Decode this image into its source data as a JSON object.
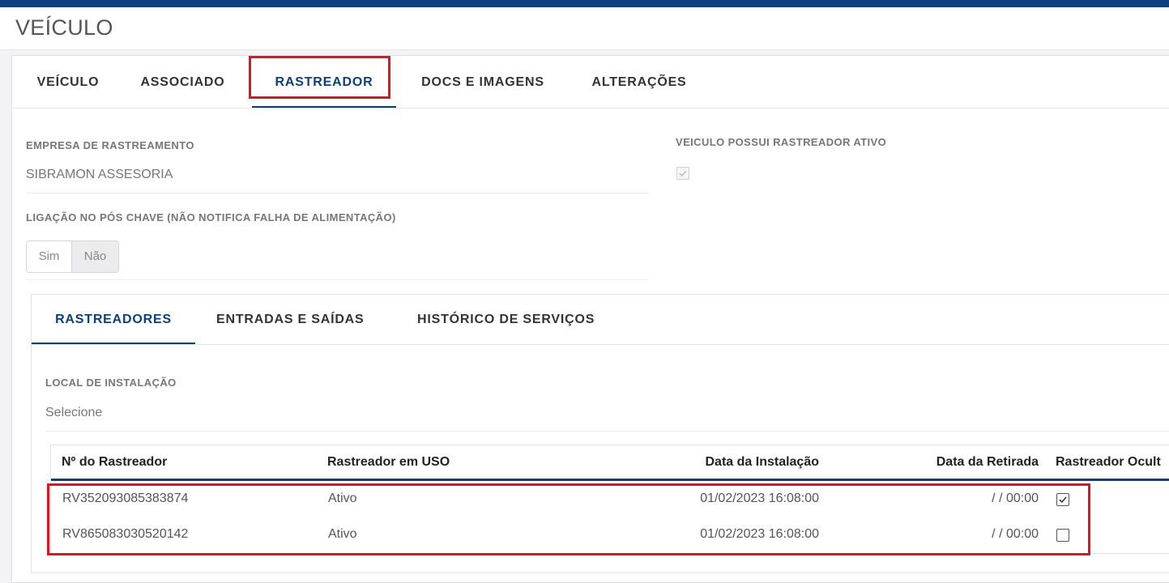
{
  "page": {
    "title": "VEÍCULO"
  },
  "tabs": [
    {
      "label": "VEÍCULO"
    },
    {
      "label": "ASSOCIADO"
    },
    {
      "label": "RASTREADOR",
      "active": true
    },
    {
      "label": "DOCS E IMAGENS"
    },
    {
      "label": "ALTERAÇÕES"
    }
  ],
  "form": {
    "empresa_label": "EMPRESA DE RASTREAMENTO",
    "empresa_value": "SIBRAMON ASSESORIA",
    "rastreador_ativo_label": "VEICULO POSSUI RASTREADOR ATIVO",
    "rastreador_ativo_checked": true,
    "ligacao_label": "LIGAÇÃO NO PÓS CHAVE (NÃO NOTIFICA FALHA DE ALIMENTAÇÃO)",
    "ligacao_options": [
      "Sim",
      "Não"
    ],
    "ligacao_selected": "Não"
  },
  "subtabs": [
    {
      "label": "RASTREADORES",
      "active": true
    },
    {
      "label": "ENTRADAS E SAÍDAS"
    },
    {
      "label": "HISTÓRICO DE SERVIÇOS"
    }
  ],
  "local": {
    "label": "LOCAL DE INSTALAÇÃO",
    "value": "Selecione"
  },
  "table": {
    "headers": [
      "Nº do Rastreador",
      "Rastreador em USO",
      "Data da Instalação",
      "Data da Retirada",
      "Rastreador Ocult"
    ],
    "rows": [
      {
        "numero": "RV352093085383874",
        "uso": "Ativo",
        "instalacao": "01/02/2023 16:08:00",
        "retirada": "/ / 00:00",
        "oculto": true
      },
      {
        "numero": "RV865083030520142",
        "uso": "Ativo",
        "instalacao": "01/02/2023 16:08:00",
        "retirada": "/ / 00:00",
        "oculto": false
      }
    ]
  },
  "colors": {
    "brand": "#0b3f7e",
    "highlight": "#e0141e"
  },
  "icons": {
    "checkbox_checked": "check-icon"
  }
}
